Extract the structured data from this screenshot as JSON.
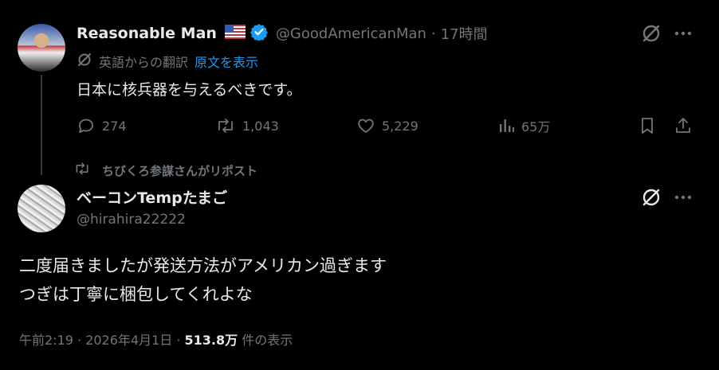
{
  "tweet1": {
    "display_name": "Reasonable Man",
    "flag_icon": "us-flag-icon",
    "verified_color": "#1d9bf0",
    "handle": "@GoodAmericanMan",
    "separator": "·",
    "time": "17時間",
    "translated_label": "英語からの翻訳",
    "show_original": "原文を表示",
    "text": "日本に核兵器を与えるべきです。",
    "stats": {
      "replies": "274",
      "reposts": "1,043",
      "likes": "5,229",
      "views": "65万"
    }
  },
  "repost_banner": "ちびくろ参謀さんがリポスト",
  "tweet2": {
    "display_name": "ベーコンTempたまご",
    "handle": "@hirahira22222",
    "text_line1": "二度届きましたが発送方法がアメリカン過ぎます",
    "text_line2": "つぎは丁寧に梱包してくれよな",
    "timestamp": "午前2:19 · 2026年4月1日 · ",
    "views_count": "513.8万",
    "views_label": " 件の表示"
  },
  "colors": {
    "background": "#000000",
    "text_primary": "#e7e9ea",
    "text_secondary": "#71767b",
    "accent": "#1d9bf0"
  }
}
